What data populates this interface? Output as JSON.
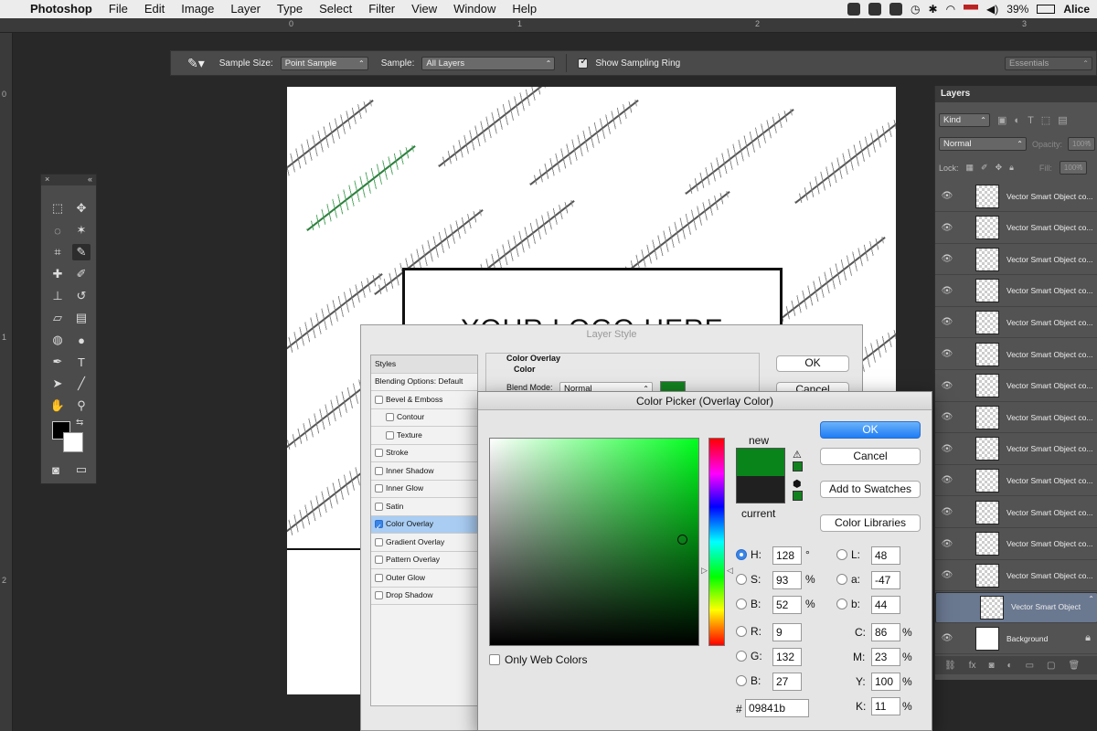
{
  "menubar": {
    "apple": "",
    "app": "Photoshop",
    "items": [
      "File",
      "Edit",
      "Image",
      "Layer",
      "Type",
      "Select",
      "Filter",
      "View",
      "Window",
      "Help"
    ],
    "battery": "39%",
    "user": "Alice"
  },
  "rulers": {
    "top": [
      "0",
      "1",
      "2",
      "3"
    ],
    "left": [
      "0",
      "1",
      "2"
    ]
  },
  "options": {
    "sample_size_label": "Sample Size:",
    "sample_size_value": "Point Sample",
    "sample_label": "Sample:",
    "sample_value": "All Layers",
    "sampling_ring_label": "Show Sampling Ring",
    "workspace": "Essentials"
  },
  "tools_panel": {
    "close": "×",
    "collapse": "«"
  },
  "canvas": {
    "logo_text": "YOUR LOGO HERE"
  },
  "layers_panel": {
    "tab": "Layers",
    "filter": "Kind",
    "blend_mode": "Normal",
    "opacity_label": "Opacity:",
    "opacity_value": "100%",
    "lock_label": "Lock:",
    "fill_label": "Fill:",
    "fill_value": "100%",
    "layers": [
      "Vector Smart Object co...",
      "Vector Smart Object co...",
      "Vector Smart Object co...",
      "Vector Smart Object co...",
      "Vector Smart Object co...",
      "Vector Smart Object co...",
      "Vector Smart Object co...",
      "Vector Smart Object co...",
      "Vector Smart Object co...",
      "Vector Smart Object co...",
      "Vector Smart Object co...",
      "Vector Smart Object co...",
      "Vector Smart Object co..."
    ],
    "selected_layer": "Vector Smart Object",
    "background_layer": "Background"
  },
  "layer_style": {
    "title": "Layer Style",
    "styles_header": "Styles",
    "blending": "Blending Options: Default",
    "items": [
      {
        "label": "Bevel & Emboss",
        "sub": false,
        "checked": false
      },
      {
        "label": "Contour",
        "sub": true,
        "checked": false
      },
      {
        "label": "Texture",
        "sub": true,
        "checked": false
      },
      {
        "label": "Stroke",
        "sub": false,
        "checked": false
      },
      {
        "label": "Inner Shadow",
        "sub": false,
        "checked": false
      },
      {
        "label": "Inner Glow",
        "sub": false,
        "checked": false
      },
      {
        "label": "Satin",
        "sub": false,
        "checked": false
      },
      {
        "label": "Color Overlay",
        "sub": false,
        "checked": true
      },
      {
        "label": "Gradient Overlay",
        "sub": false,
        "checked": false
      },
      {
        "label": "Pattern Overlay",
        "sub": false,
        "checked": false
      },
      {
        "label": "Outer Glow",
        "sub": false,
        "checked": false
      },
      {
        "label": "Drop Shadow",
        "sub": false,
        "checked": false
      }
    ],
    "section_title": "Color Overlay",
    "group_title": "Color",
    "blend_mode_label": "Blend Mode:",
    "blend_mode_value": "Normal",
    "ok": "OK",
    "cancel": "Cancel",
    "overlay_color": "#12821f"
  },
  "color_picker": {
    "title": "Color Picker (Overlay Color)",
    "new_label": "new",
    "current_label": "current",
    "new_color": "#09841b",
    "current_color": "#202020",
    "ok": "OK",
    "cancel": "Cancel",
    "add_swatches": "Add to Swatches",
    "libraries": "Color Libraries",
    "only_web": "Only Web Colors",
    "hsb": [
      {
        "label": "H:",
        "value": "128",
        "unit": "°"
      },
      {
        "label": "S:",
        "value": "93",
        "unit": "%"
      },
      {
        "label": "B:",
        "value": "52",
        "unit": "%"
      }
    ],
    "rgb": [
      {
        "label": "R:",
        "value": "9"
      },
      {
        "label": "G:",
        "value": "132"
      },
      {
        "label": "B:",
        "value": "27"
      }
    ],
    "lab": [
      {
        "label": "L:",
        "value": "48"
      },
      {
        "label": "a:",
        "value": "-47"
      },
      {
        "label": "b:",
        "value": "44"
      }
    ],
    "cmyk": [
      {
        "label": "C:",
        "value": "86",
        "unit": "%"
      },
      {
        "label": "M:",
        "value": "23",
        "unit": "%"
      },
      {
        "label": "Y:",
        "value": "100",
        "unit": "%"
      },
      {
        "label": "K:",
        "value": "11",
        "unit": "%"
      }
    ],
    "hex_label": "#",
    "hex_value": "09841b"
  }
}
